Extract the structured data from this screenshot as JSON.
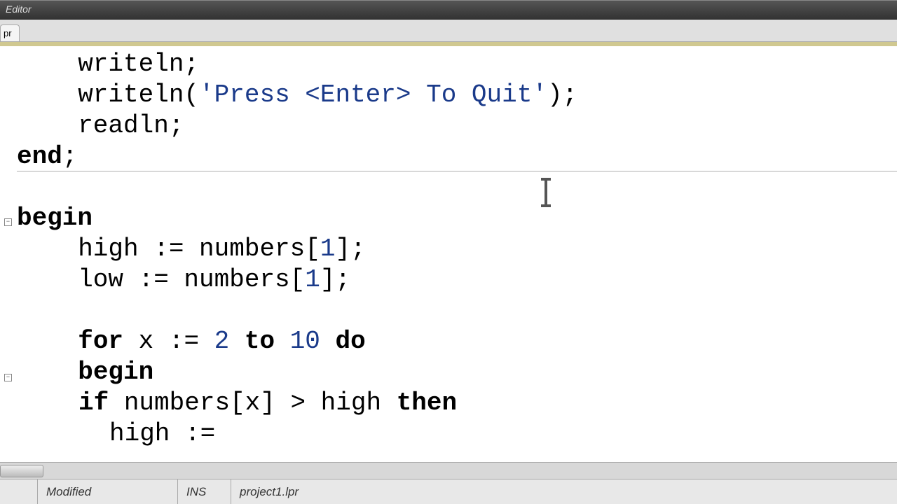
{
  "window": {
    "title": "Editor"
  },
  "tab": {
    "label": "pr"
  },
  "code": {
    "l1_a": "  writeln;",
    "l2_a": "  writeln(",
    "l2_str": "'Press <Enter> To Quit'",
    "l2_b": ");",
    "l3_a": "  readln;",
    "l4_kw": "end",
    "l4_b": ";",
    "l5_kw": "begin",
    "l6_a": "  high := numbers[",
    "l6_num": "1",
    "l6_b": "];",
    "l7_a": "  low := numbers[",
    "l7_num": "1",
    "l7_b": "];",
    "l8_kwfor": "for",
    "l8_a": " x := ",
    "l8_num2": "2",
    "l8_kwto": "to",
    "l8_num10": "10",
    "l8_kwdo": "do",
    "l9_kw": "begin",
    "l10_kwif": "if",
    "l10_a": " numbers[x] > high ",
    "l10_kwthen": "then",
    "l11_a": "high :="
  },
  "status": {
    "modified": "Modified",
    "ins": "INS",
    "file": "project1.lpr"
  },
  "fold": {
    "glyph": "−"
  }
}
